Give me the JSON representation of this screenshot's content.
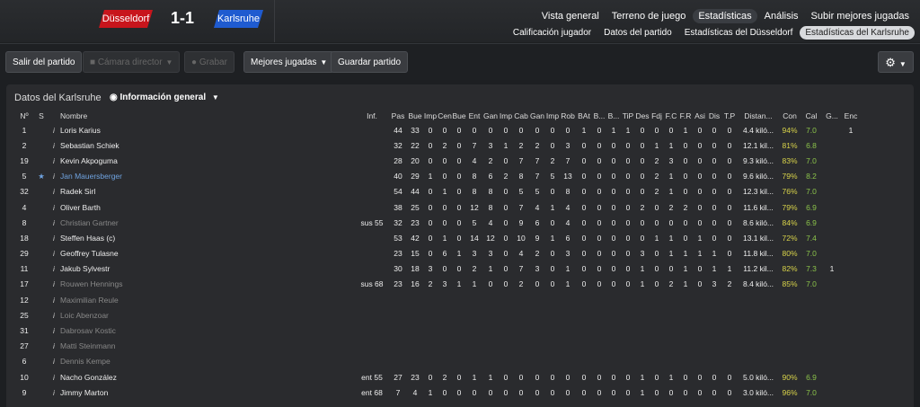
{
  "match": {
    "home": "Düsseldorf",
    "away": "Karlsruhe",
    "score": "1-1"
  },
  "nav": {
    "primary": [
      "Vista general",
      "Terreno de juego",
      "Estadísticas",
      "Análisis",
      "Subir mejores jugadas"
    ],
    "secondary": [
      "Calificación jugador",
      "Datos del partido",
      "Estadísticas del Düsseldorf",
      "Estadísticas del Karlsruhe"
    ]
  },
  "toolbar": {
    "exit": "Salir del partido",
    "camera": "Cámara director",
    "record": "Grabar",
    "highlights": "Mejores jugadas",
    "save": "Guardar partido"
  },
  "panel": {
    "title": "Datos del Karlsruhe",
    "view": "Información general"
  },
  "columns": [
    "Nº",
    "S",
    "Nombre",
    "Inf.",
    "Pas",
    "Bue",
    "Imp",
    "Cen",
    "Bue",
    "Ent",
    "Gan",
    "Imp",
    "Cab",
    "Gan",
    "Imp",
    "Rob",
    "BAt",
    "B...",
    "B...",
    "TiP",
    "Des",
    "Fdj",
    "F.C",
    "F.R",
    "Asi",
    "Dis",
    "T.P",
    "Distan...",
    "Con",
    "Cal",
    "G...",
    "Enc"
  ],
  "rows": [
    {
      "no": "1",
      "s": "",
      "name": "Loris Karius",
      "inf": "",
      "v": [
        "44",
        "33",
        "0",
        "0",
        "0",
        "0",
        "0",
        "0",
        "0",
        "0",
        "0",
        "0",
        "1",
        "0",
        "1",
        "1",
        "0",
        "0",
        "0",
        "1",
        "0",
        "0",
        "0"
      ],
      "dist": "4.4 kiló...",
      "con": "94%",
      "cal": "7.0",
      "g": "",
      "enc": "1"
    },
    {
      "no": "2",
      "s": "",
      "name": "Sebastian Schiek",
      "inf": "",
      "v": [
        "32",
        "22",
        "0",
        "2",
        "0",
        "7",
        "3",
        "1",
        "2",
        "2",
        "0",
        "3",
        "0",
        "0",
        "0",
        "0",
        "0",
        "1",
        "1",
        "0",
        "0",
        "0",
        "0"
      ],
      "dist": "12.1 kil...",
      "con": "81%",
      "cal": "6.8",
      "g": "",
      "enc": ""
    },
    {
      "no": "19",
      "s": "",
      "name": "Kevin Akpoguma",
      "inf": "",
      "v": [
        "28",
        "20",
        "0",
        "0",
        "0",
        "4",
        "2",
        "0",
        "7",
        "7",
        "2",
        "7",
        "0",
        "0",
        "0",
        "0",
        "0",
        "2",
        "3",
        "0",
        "0",
        "0",
        "0"
      ],
      "dist": "9.3 kiló...",
      "con": "83%",
      "cal": "7.0",
      "g": "",
      "enc": ""
    },
    {
      "no": "5",
      "s": "★",
      "name": "Jan Mauersberger",
      "inf": "",
      "v": [
        "40",
        "29",
        "1",
        "0",
        "0",
        "8",
        "6",
        "2",
        "8",
        "7",
        "5",
        "13",
        "0",
        "0",
        "0",
        "0",
        "0",
        "2",
        "1",
        "0",
        "0",
        "0",
        "0"
      ],
      "dist": "9.6 kiló...",
      "con": "79%",
      "cal": "8.2",
      "g": "",
      "enc": ""
    },
    {
      "no": "32",
      "s": "",
      "name": "Radek Sirl",
      "inf": "",
      "v": [
        "54",
        "44",
        "0",
        "1",
        "0",
        "8",
        "8",
        "0",
        "5",
        "5",
        "0",
        "8",
        "0",
        "0",
        "0",
        "0",
        "0",
        "2",
        "1",
        "0",
        "0",
        "0",
        "0"
      ],
      "dist": "12.3 kil...",
      "con": "76%",
      "cal": "7.0",
      "g": "",
      "enc": ""
    },
    {
      "no": "4",
      "s": "",
      "name": "Oliver Barth",
      "inf": "",
      "v": [
        "38",
        "25",
        "0",
        "0",
        "0",
        "12",
        "8",
        "0",
        "7",
        "4",
        "1",
        "4",
        "0",
        "0",
        "0",
        "0",
        "2",
        "0",
        "2",
        "2",
        "0",
        "0",
        "0"
      ],
      "dist": "11.6 kil...",
      "con": "79%",
      "cal": "6.9",
      "g": "",
      "enc": ""
    },
    {
      "no": "8",
      "s": "",
      "name": "Christian Gartner",
      "inf": "sus 55",
      "v": [
        "32",
        "23",
        "0",
        "0",
        "0",
        "5",
        "4",
        "0",
        "9",
        "6",
        "0",
        "4",
        "0",
        "0",
        "0",
        "0",
        "0",
        "0",
        "0",
        "0",
        "0",
        "0",
        "0"
      ],
      "dist": "8.6 kiló...",
      "con": "84%",
      "cal": "6.9",
      "g": "",
      "enc": "",
      "sub": true
    },
    {
      "no": "18",
      "s": "",
      "name": "Steffen Haas (c)",
      "inf": "",
      "v": [
        "53",
        "42",
        "0",
        "1",
        "0",
        "14",
        "12",
        "0",
        "10",
        "9",
        "1",
        "6",
        "0",
        "0",
        "0",
        "0",
        "0",
        "1",
        "1",
        "0",
        "1",
        "0",
        "0"
      ],
      "dist": "13.1 kil...",
      "con": "72%",
      "cal": "7.4",
      "g": "",
      "enc": ""
    },
    {
      "no": "29",
      "s": "",
      "name": "Geoffrey Tulasne",
      "inf": "",
      "v": [
        "23",
        "15",
        "0",
        "6",
        "1",
        "3",
        "3",
        "0",
        "4",
        "2",
        "0",
        "3",
        "0",
        "0",
        "0",
        "0",
        "3",
        "0",
        "1",
        "1",
        "1",
        "1",
        "0"
      ],
      "dist": "11.8 kil...",
      "con": "80%",
      "cal": "7.0",
      "g": "",
      "enc": ""
    },
    {
      "no": "11",
      "s": "",
      "name": "Jakub Sylvestr",
      "inf": "",
      "v": [
        "30",
        "18",
        "3",
        "0",
        "0",
        "2",
        "1",
        "0",
        "7",
        "3",
        "0",
        "1",
        "0",
        "0",
        "0",
        "0",
        "1",
        "0",
        "0",
        "1",
        "0",
        "1",
        "1"
      ],
      "dist": "11.2 kil...",
      "con": "82%",
      "cal": "7.3",
      "g": "1",
      "enc": ""
    },
    {
      "no": "17",
      "s": "",
      "name": "Rouwen Hennings",
      "inf": "sus 68",
      "v": [
        "23",
        "16",
        "2",
        "3",
        "1",
        "1",
        "0",
        "0",
        "2",
        "0",
        "0",
        "1",
        "0",
        "0",
        "0",
        "0",
        "1",
        "0",
        "2",
        "1",
        "0",
        "3",
        "2"
      ],
      "dist": "8.4 kiló...",
      "con": "85%",
      "cal": "7.0",
      "g": "",
      "enc": "",
      "sub": true
    },
    {
      "no": "12",
      "s": "",
      "name": "Maximilian Reule",
      "inf": "",
      "v": [],
      "dist": "",
      "con": "",
      "cal": "",
      "g": "",
      "enc": "",
      "sub": true
    },
    {
      "no": "25",
      "s": "",
      "name": "Loic Abenzoar",
      "inf": "",
      "v": [],
      "dist": "",
      "con": "",
      "cal": "",
      "g": "",
      "enc": "",
      "sub": true
    },
    {
      "no": "31",
      "s": "",
      "name": "Dabrosav Kostic",
      "inf": "",
      "v": [],
      "dist": "",
      "con": "",
      "cal": "",
      "g": "",
      "enc": "",
      "sub": true
    },
    {
      "no": "27",
      "s": "",
      "name": "Matti Steinmann",
      "inf": "",
      "v": [],
      "dist": "",
      "con": "",
      "cal": "",
      "g": "",
      "enc": "",
      "sub": true
    },
    {
      "no": "6",
      "s": "",
      "name": "Dennis Kempe",
      "inf": "",
      "v": [],
      "dist": "",
      "con": "",
      "cal": "",
      "g": "",
      "enc": "",
      "sub": true
    },
    {
      "no": "10",
      "s": "",
      "name": "Nacho González",
      "inf": "ent 55",
      "v": [
        "27",
        "23",
        "0",
        "2",
        "0",
        "1",
        "1",
        "0",
        "0",
        "0",
        "0",
        "0",
        "0",
        "0",
        "0",
        "0",
        "1",
        "0",
        "1",
        "0",
        "0",
        "0",
        "0"
      ],
      "dist": "5.0 kiló...",
      "con": "90%",
      "cal": "6.9",
      "g": "",
      "enc": ""
    },
    {
      "no": "9",
      "s": "",
      "name": "Jimmy Marton",
      "inf": "ent 68",
      "v": [
        "7",
        "4",
        "1",
        "0",
        "0",
        "0",
        "0",
        "0",
        "0",
        "0",
        "0",
        "0",
        "0",
        "0",
        "0",
        "0",
        "1",
        "0",
        "0",
        "0",
        "0",
        "0",
        "0"
      ],
      "dist": "3.0 kiló...",
      "con": "96%",
      "cal": "7.0",
      "g": "",
      "enc": ""
    }
  ]
}
